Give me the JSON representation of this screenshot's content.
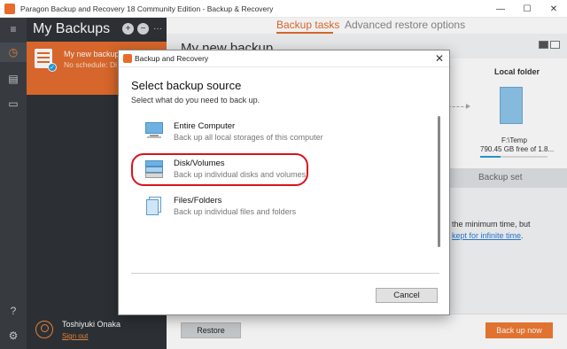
{
  "window": {
    "title": "Paragon Backup and Recovery 18 Community Edition - Backup & Recovery",
    "controls": {
      "minimize": "—",
      "maximize": "☐",
      "close": "✕"
    }
  },
  "rail": {
    "icons": [
      "menu-icon",
      "clock-icon",
      "drives-icon",
      "archive-icon",
      "help-icon",
      "settings-icon"
    ],
    "glyphs": {
      "menu": "≡",
      "clock": "◷",
      "drives": "▤",
      "archive": "▭",
      "help": "?",
      "settings": "⚙"
    }
  },
  "backups_panel": {
    "header": "My Backups",
    "add_glyph": "+",
    "remove_glyph": "−",
    "more_glyph": "···",
    "item": {
      "name": "My new backup",
      "schedule": "No schedule: Di"
    },
    "user": {
      "name": "Toshiyuki Onaka",
      "sign_out": "Sign out"
    }
  },
  "main": {
    "tabs": [
      {
        "label": "Backup tasks",
        "active": true
      },
      {
        "label": "Advanced restore options",
        "active": false
      }
    ],
    "task_title": "My new backup",
    "local_folder": {
      "title": "Local folder",
      "path": "F:\\Temp",
      "free": "790.45 GB free of 1.8..."
    },
    "backup_set_label": "Backup set",
    "min_time_text": "the minimum time, but",
    "infinite_link": "kept for infinite time",
    "infinite_suffix": ".",
    "restore_button": "Restore",
    "backup_now_button": "Back up now"
  },
  "dialog": {
    "title": "Backup and Recovery",
    "close_glyph": "✕",
    "heading": "Select backup source",
    "subheading": "Select what do you need to back up.",
    "options": [
      {
        "label": "Entire Computer",
        "description": "Back up all local storages of this computer",
        "icon": "computer-icon"
      },
      {
        "label": "Disk/Volumes",
        "description": "Back up individual disks and volumes",
        "icon": "disk-icon",
        "highlighted": true
      },
      {
        "label": "Files/Folders",
        "description": "Back up individual files and folders",
        "icon": "files-icon"
      }
    ],
    "cancel_button": "Cancel"
  },
  "colors": {
    "accent": "#e46d2e",
    "sidebar": "#2f3338",
    "highlight_ring": "#d8141c",
    "link": "#2b7cd8"
  }
}
